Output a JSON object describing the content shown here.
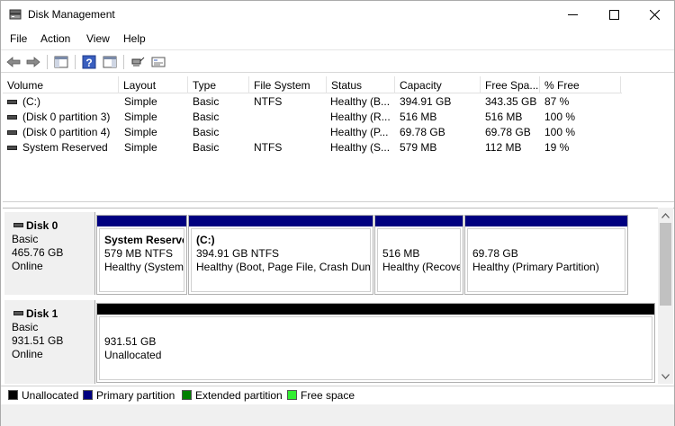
{
  "window": {
    "title": "Disk Management"
  },
  "menu": {
    "items": [
      "File",
      "Action",
      "View",
      "Help"
    ]
  },
  "table": {
    "columns": [
      "Volume",
      "Layout",
      "Type",
      "File System",
      "Status",
      "Capacity",
      "Free Spa...",
      "% Free"
    ],
    "rows": [
      [
        "(C:)",
        "Simple",
        "Basic",
        "NTFS",
        "Healthy (B...",
        "394.91 GB",
        "343.35 GB",
        "87 %"
      ],
      [
        "(Disk 0 partition 3)",
        "Simple",
        "Basic",
        "",
        "Healthy (R...",
        "516 MB",
        "516 MB",
        "100 %"
      ],
      [
        "(Disk 0 partition 4)",
        "Simple",
        "Basic",
        "",
        "Healthy (P...",
        "69.78 GB",
        "69.78 GB",
        "100 %"
      ],
      [
        "System Reserved",
        "Simple",
        "Basic",
        "NTFS",
        "Healthy (S...",
        "579 MB",
        "112 MB",
        "19 %"
      ]
    ]
  },
  "disks": [
    {
      "name": "Disk 0",
      "type": "Basic",
      "size": "465.76 GB",
      "state": "Online",
      "partitions": [
        {
          "title": "System Reserve",
          "line1": "579 MB NTFS",
          "line2": "Healthy (System"
        },
        {
          "title": "(C:)",
          "line1": "394.91 GB NTFS",
          "line2": "Healthy (Boot, Page File, Crash Dum"
        },
        {
          "title": "",
          "line1": "516 MB",
          "line2": "Healthy (Recove"
        },
        {
          "title": "",
          "line1": "69.78 GB",
          "line2": "Healthy (Primary Partition)"
        }
      ]
    },
    {
      "name": "Disk 1",
      "type": "Basic",
      "size": "931.51 GB",
      "state": "Online",
      "partitions": [
        {
          "title": "",
          "line1": "931.51 GB",
          "line2": "Unallocated"
        }
      ]
    }
  ],
  "legend": [
    {
      "label": "Unallocated",
      "color": "#000000"
    },
    {
      "label": "Primary partition",
      "color": "#000080"
    },
    {
      "label": "Extended partition",
      "color": "#008000"
    },
    {
      "label": "Free space",
      "color": "#33ee33"
    }
  ],
  "colors": {
    "primary": "#000080",
    "unallocated": "#000000"
  }
}
